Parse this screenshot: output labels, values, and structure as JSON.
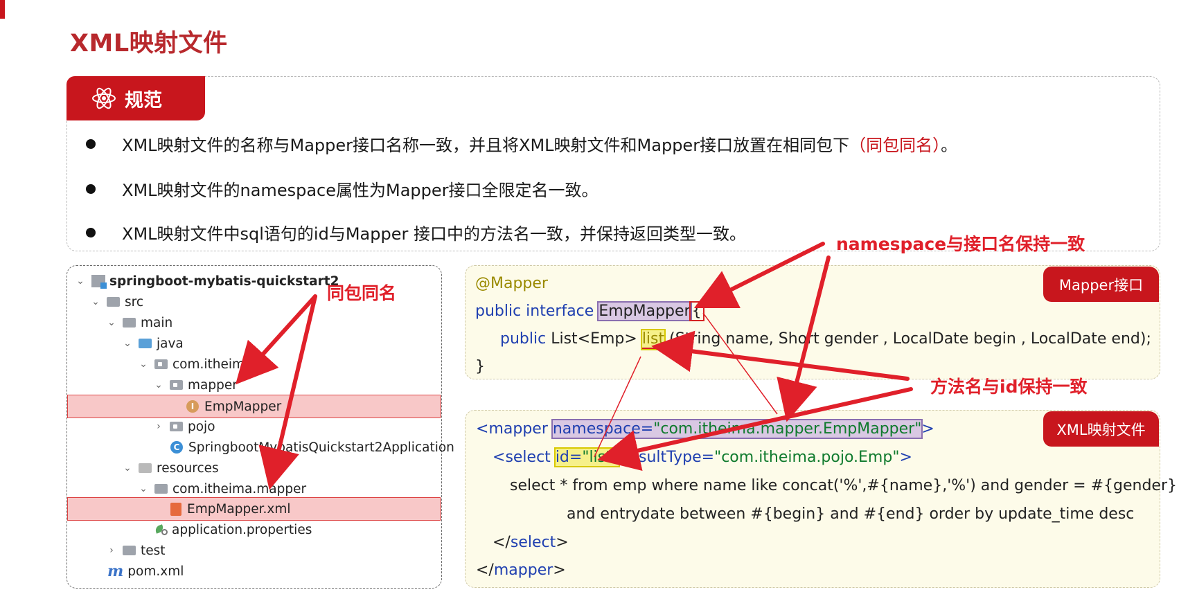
{
  "page": {
    "title": "XML映射文件"
  },
  "rules": {
    "tab_label": "规范",
    "tab_icon": "atom-icon",
    "items": [
      {
        "text": "XML映射文件的名称与Mapper接口名称一致，并且将XML映射文件和Mapper接口放置在相同包下",
        "highlight": "（同包同名）",
        "suffix": "。"
      },
      {
        "text": "XML映射文件的namespace属性为Mapper接口全限定名一致。",
        "highlight": "",
        "suffix": ""
      },
      {
        "text": "XML映射文件中sql语句的id与Mapper 接口中的方法名一致，并保持返回类型一致。",
        "highlight": "",
        "suffix": ""
      }
    ]
  },
  "tree": {
    "items": [
      {
        "label": "springboot-mybatis-quickstart2",
        "icon": "project-icon",
        "expanded": true
      },
      {
        "label": "src",
        "icon": "folder-icon",
        "expanded": true
      },
      {
        "label": "main",
        "icon": "folder-icon",
        "expanded": true
      },
      {
        "label": "java",
        "icon": "source-folder-icon",
        "expanded": true
      },
      {
        "label": "com.itheima",
        "icon": "package-icon",
        "expanded": true
      },
      {
        "label": "mapper",
        "icon": "package-icon",
        "expanded": true
      },
      {
        "label": "EmpMapper",
        "icon": "interface-icon",
        "highlighted": true
      },
      {
        "label": "pojo",
        "icon": "package-icon",
        "expanded": false
      },
      {
        "label": "SpringbootMybatisQuickstart2Application",
        "icon": "spring-class-icon"
      },
      {
        "label": "resources",
        "icon": "resources-folder-icon",
        "expanded": true
      },
      {
        "label": "com.itheima.mapper",
        "icon": "folder-icon",
        "expanded": true
      },
      {
        "label": "EmpMapper.xml",
        "icon": "xml-file-icon",
        "highlighted": true
      },
      {
        "label": "application.properties",
        "icon": "properties-icon"
      },
      {
        "label": "test",
        "icon": "folder-icon",
        "expanded": false
      },
      {
        "label": "pom.xml",
        "icon": "maven-icon"
      }
    ]
  },
  "mapper_code": {
    "tab_label": "Mapper接口",
    "annotation": "@Mapper",
    "decl_prefix": "public interface ",
    "interface_name": "EmpMapper",
    "open_brace": "{",
    "method_prefix_kw": "public",
    "method_return": " List<Emp> ",
    "method_name": "list",
    "method_params": " (String name, Short gender , LocalDate begin , LocalDate end);",
    "close_brace": "}"
  },
  "xml_code": {
    "tab_label": "XML映射文件",
    "mapper_open_lt": "<",
    "mapper_tag": "mapper",
    "ns_attr": "namespace=",
    "ns_value": "\"com.itheima.mapper.EmpMapper\"",
    "mapper_open_gt": ">",
    "select_lt": "<",
    "select_tag": "select",
    "id_attr": "id=",
    "id_value": "\"list\"",
    "result_attr": " resultType=",
    "result_value": "\"com.itheima.pojo.Emp\"",
    "select_gt": ">",
    "sql_line1": "select * from emp where name like concat('%',#{name},'%') and gender = #{gender}",
    "sql_line2": "and entrydate between #{begin} and #{end} order by update_time desc",
    "select_close_lt": "</",
    "select_close_tag": "select",
    "select_close_gt": ">",
    "mapper_close_lt": "</",
    "mapper_close_tag": "mapper",
    "mapper_close_gt": ">"
  },
  "callouts": {
    "same_package": "同包同名",
    "namespace": "namespace与接口名保持一致",
    "method_id": "方法名与id保持一致"
  },
  "colors": {
    "brand_red": "#c8161d",
    "callout_red": "#e0202a",
    "keyword_blue": "#1f3fb0",
    "string_green": "#0f7a2d",
    "annotation_olive": "#9a8a00"
  }
}
